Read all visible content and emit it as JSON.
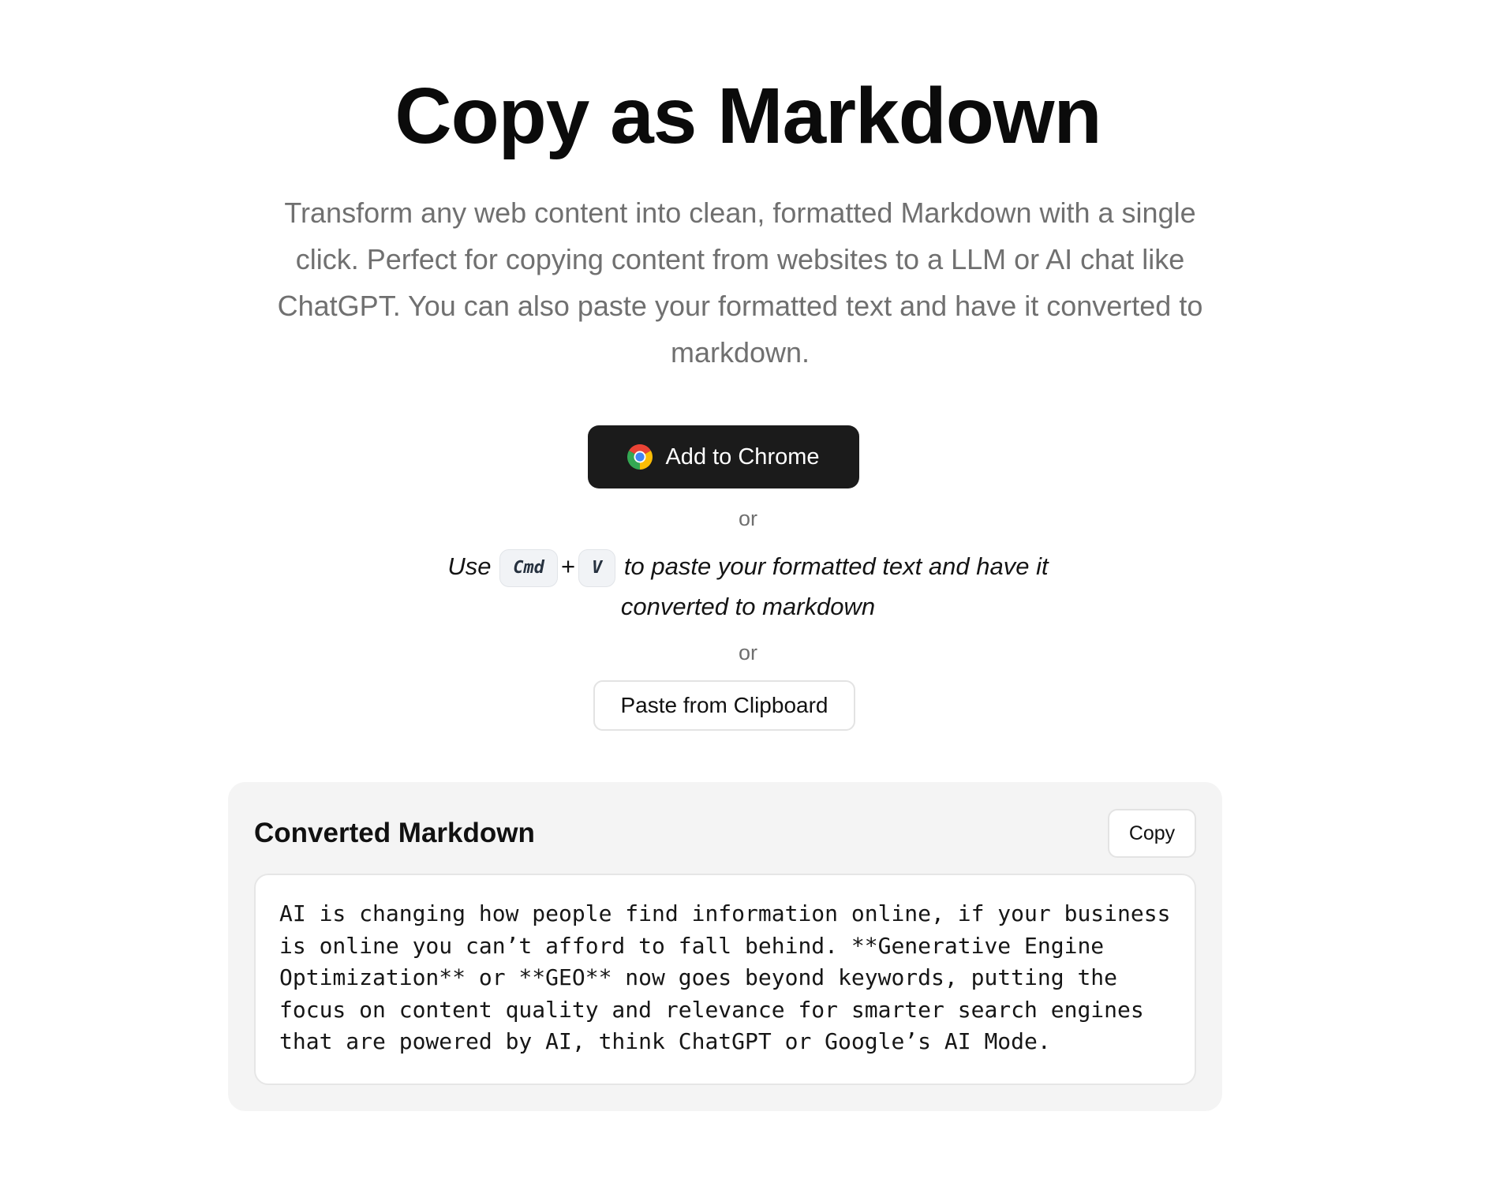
{
  "hero": {
    "title": "Copy as Markdown",
    "subtitle": "Transform any web content into clean, formatted Markdown with a single click. Perfect for copying content from websites to a LLM or AI chat like ChatGPT. You can also paste your formatted text and have it converted to markdown."
  },
  "actions": {
    "chrome_button_label": "Add to Chrome",
    "chrome_icon": "chrome-logo-icon",
    "or_label": "or",
    "paste_hint": {
      "prefix": "Use",
      "key_1": "Cmd",
      "plus": "+",
      "key_2": "V",
      "suffix": "to paste your formatted text and have it converted to markdown"
    },
    "clipboard_button_label": "Paste from Clipboard"
  },
  "result": {
    "title": "Converted Markdown",
    "copy_button_label": "Copy",
    "content": "AI is changing how people find information online, if your business is online you can’t afford to fall behind. **Generative Engine Optimization** or **GEO** now goes beyond keywords, putting the focus on content quality and relevance for smarter search engines that are powered by AI, think ChatGPT or Google’s AI Mode."
  },
  "colors": {
    "primary_button": "#1b1b1b",
    "muted_text": "#707070",
    "card_background": "#f4f4f4"
  }
}
